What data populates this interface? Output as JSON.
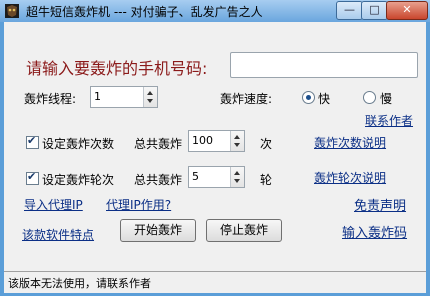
{
  "window": {
    "title": "超牛短信轰炸机 --- 对付骗子、乱发广告之人"
  },
  "form": {
    "prompt": "请输入要轰炸的手机号码:",
    "phone_value": "",
    "threads_label": "轰炸线程:",
    "threads_value": "1",
    "speed_label": "轰炸速度:",
    "speed_fast": "快",
    "speed_slow": "慢",
    "contact_author": "联系作者",
    "set_count_label": "设定轰炸次数",
    "total1_label": "总共轰炸",
    "count_value": "100",
    "count_unit": "次",
    "count_help": "轰炸次数说明",
    "set_round_label": "设定轰炸轮次",
    "total2_label": "总共轰炸",
    "round_value": "5",
    "round_unit": "轮",
    "round_help": "轰炸轮次说明",
    "import_proxy": "导入代理IP",
    "proxy_use": "代理IP作用?",
    "disclaimer": "免责声明",
    "features": "该款软件特点",
    "start_button": "开始轰炸",
    "stop_button": "停止轰炸",
    "enter_code": "输入轰炸码"
  },
  "status": {
    "text": "该版本无法使用，请联系作者"
  }
}
